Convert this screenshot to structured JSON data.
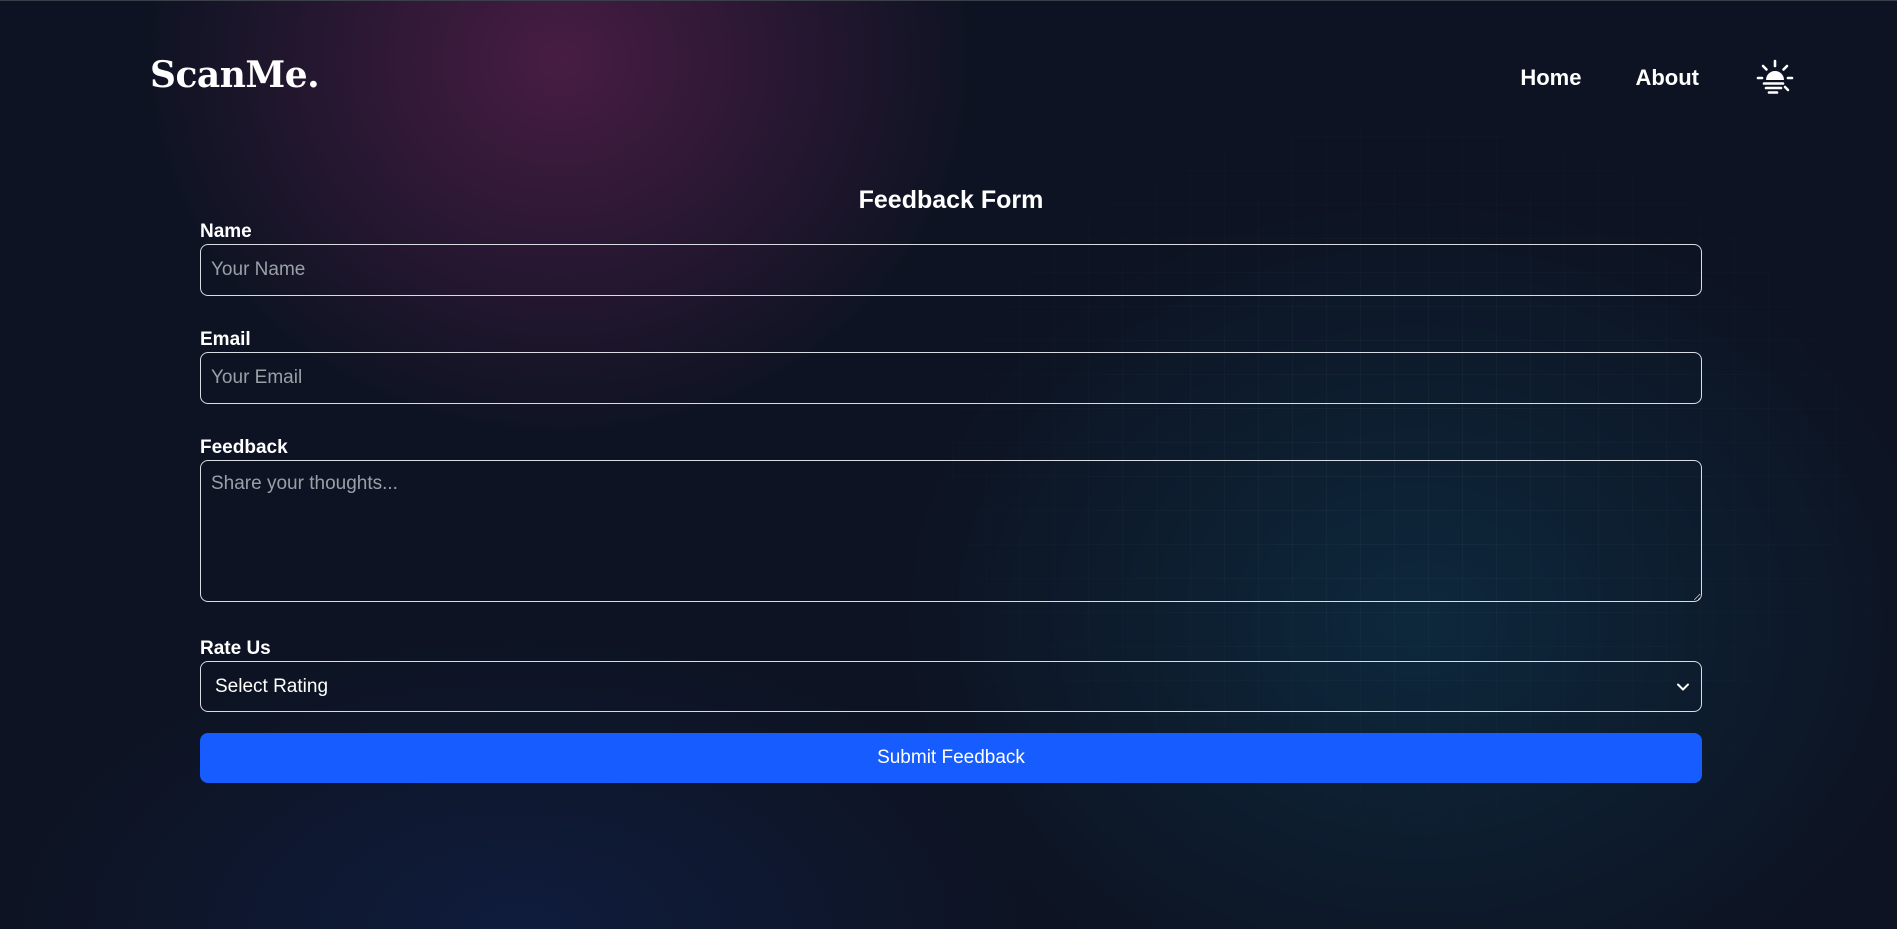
{
  "header": {
    "logo": "ScanMe.",
    "nav": [
      {
        "label": "Home"
      },
      {
        "label": "About"
      }
    ],
    "theme_toggle_icon": "sun-icon"
  },
  "form": {
    "title": "Feedback Form",
    "name": {
      "label": "Name",
      "placeholder": "Your Name",
      "value": ""
    },
    "email": {
      "label": "Email",
      "placeholder": "Your Email",
      "value": ""
    },
    "feedback": {
      "label": "Feedback",
      "placeholder": "Share your thoughts...",
      "value": ""
    },
    "rating": {
      "label": "Rate Us",
      "selected": "Select Rating"
    },
    "submit_label": "Submit Feedback"
  },
  "colors": {
    "background": "#0d1322",
    "accent": "#175cff",
    "input_border": "#d9dce2",
    "placeholder": "#9aa0a8"
  }
}
